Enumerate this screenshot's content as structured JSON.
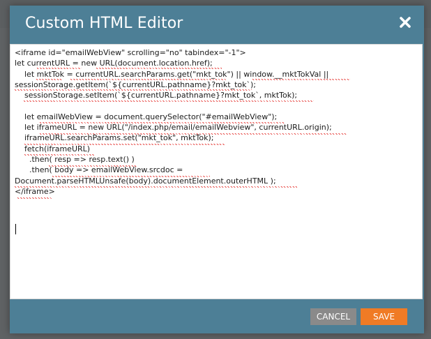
{
  "dialog": {
    "title": "Custom HTML Editor",
    "close_icon": "close-icon"
  },
  "editor": {
    "code": "<iframe id=\"emailWebView\" scrolling=\"no\" tabindex=\"-1\">\nlet currentURL = new URL(document.location.href);\n    let mktTok = currentURL.searchParams.get(\"mkt_tok\") || window.__mktTokVal ||\nsessionStorage.getItem(`${currentURL.pathname}?mkt_tok`);\n    sessionStorage.setItem(`${currentURL.pathname}?mkt_tok`, mktTok);\n\n    let emailWebView = document.querySelector(\"#emailWebView\");\n    let iframeURL = new URL(\"/index.php/email/emailWebview\", currentURL.origin);\n    iframeURL.searchParams.set(\"mkt_tok\", mktTok);\n    fetch(iframeURL)\n      .then( resp => resp.text() )\n      .then( body => emailWebView.srcdoc =\nDocument.parseHTMLUnsafe(body).documentElement.outerHTML );\n</iframe>"
  },
  "footer": {
    "cancel_label": "CANCEL",
    "save_label": "SAVE"
  },
  "colors": {
    "dialog_bg": "#4d7f96",
    "cancel_bg": "#8a8a8a",
    "save_bg": "#f07b25",
    "backdrop": "#5f6264"
  }
}
